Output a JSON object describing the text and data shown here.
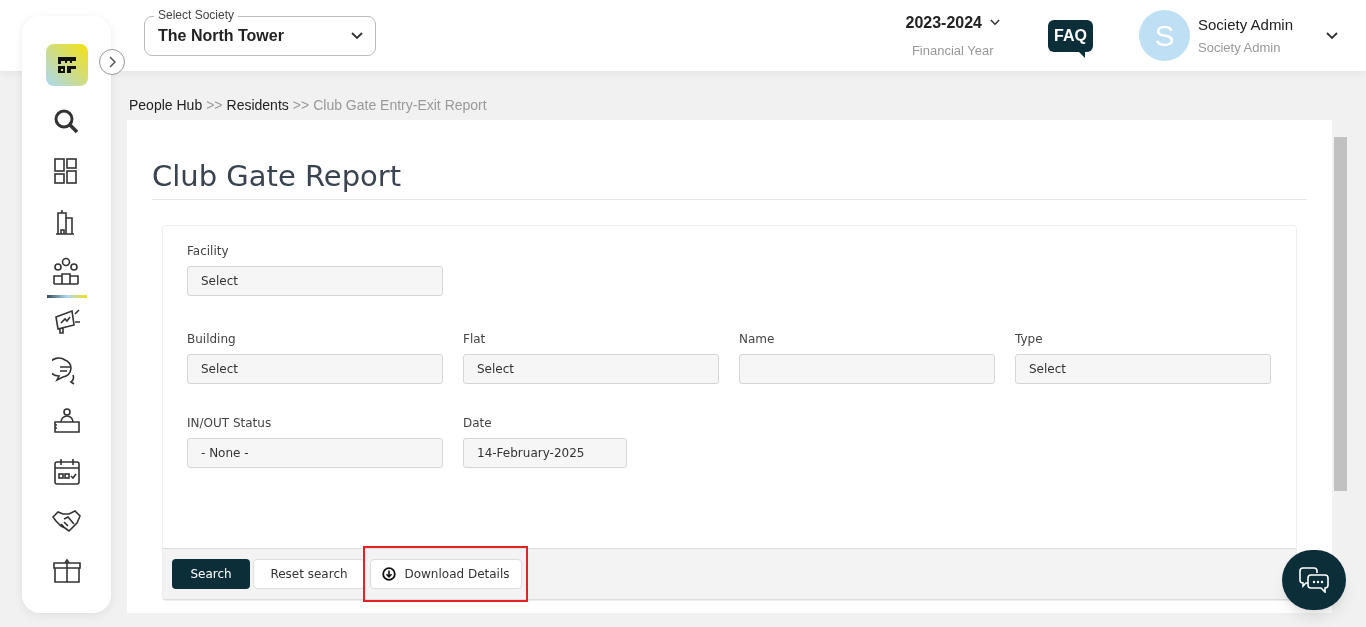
{
  "sidebar": {
    "items": [
      {
        "kind": "search",
        "selected": false
      },
      {
        "kind": "dashboard",
        "selected": false
      },
      {
        "kind": "building",
        "selected": false
      },
      {
        "kind": "people",
        "selected": true
      },
      {
        "kind": "megaphone",
        "selected": false
      },
      {
        "kind": "chat",
        "selected": false
      },
      {
        "kind": "desk",
        "selected": false
      },
      {
        "kind": "calendar",
        "selected": false
      },
      {
        "kind": "handshake",
        "selected": false
      },
      {
        "kind": "box",
        "selected": false
      }
    ]
  },
  "header": {
    "society_select": {
      "label": "Select Society",
      "value": "The North Tower"
    },
    "financial_year": {
      "value": "2023-2024",
      "label": "Financial Year"
    },
    "faq_button": "FAQ",
    "user": {
      "initial": "S",
      "name": "Society Admin",
      "role": "Society Admin"
    }
  },
  "breadcrumb": [
    {
      "kind": "link",
      "text": "People Hub"
    },
    {
      "kind": "separator",
      "text": ">>"
    },
    {
      "kind": "link",
      "text": "Residents"
    },
    {
      "kind": "separator",
      "text": ">>"
    },
    {
      "kind": "current",
      "text": "Club Gate Entry-Exit Report"
    }
  ],
  "page_title": "Club Gate Report",
  "form": {
    "rows": [
      [
        {
          "kind": "select",
          "label": "Facility",
          "value": "Select"
        }
      ],
      [
        {
          "kind": "select",
          "label": "Building",
          "value": "Select"
        },
        {
          "kind": "select",
          "label": "Flat",
          "value": "Select"
        },
        {
          "kind": "text",
          "label": "Name"
        },
        {
          "kind": "select",
          "label": "Type",
          "value": "Select"
        }
      ],
      [
        {
          "kind": "select",
          "label": "IN/OUT Status",
          "value": "- None -"
        },
        {
          "kind": "date",
          "label": "Date",
          "value": "14-February-2025"
        }
      ]
    ],
    "buttons": [
      {
        "kind": "primary",
        "label": "Search",
        "highlighted": false
      },
      {
        "kind": "secondary",
        "label": "Reset search",
        "highlighted": false
      },
      {
        "kind": "download",
        "label": "Download Details",
        "highlighted": true
      }
    ]
  }
}
